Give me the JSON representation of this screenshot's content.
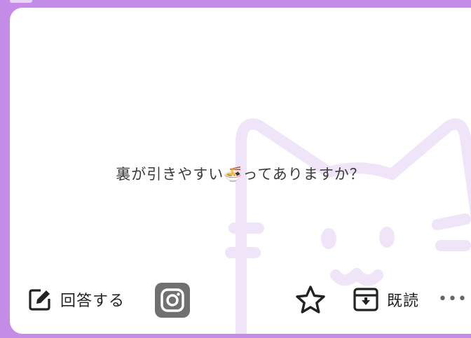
{
  "card": {
    "question": "裏が引きやすい🍜ってありますか？"
  },
  "actions": {
    "answer_label": "回答する",
    "instagram_icon": "instagram-icon",
    "star_icon": "star-outline-icon",
    "read_label": "既読",
    "more_label": "•••"
  },
  "colors": {
    "frame": "#c48ce6",
    "card": "#ffffff",
    "watermark": "#efe4f8",
    "text": "#3a3a3a",
    "instagram_bg": "#707070"
  }
}
